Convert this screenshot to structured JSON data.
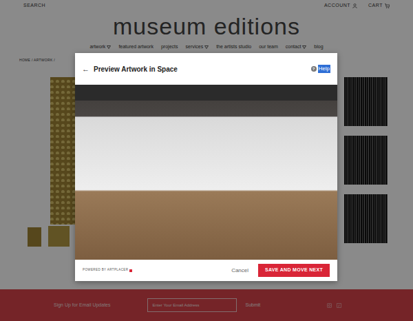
{
  "top_bar": {
    "search": "SEARCH",
    "account": "ACCOUNT",
    "cart": "CART"
  },
  "logo": "museum editions",
  "nav": [
    {
      "label": "artwork",
      "dropdown": true
    },
    {
      "label": "featured artwork",
      "dropdown": false
    },
    {
      "label": "projects",
      "dropdown": false
    },
    {
      "label": "services",
      "dropdown": true
    },
    {
      "label": "the artists studio",
      "dropdown": false
    },
    {
      "label": "our team",
      "dropdown": false
    },
    {
      "label": "contact",
      "dropdown": true
    },
    {
      "label": "blog",
      "dropdown": false
    }
  ],
  "breadcrumb": "HOME / ARTWORK /",
  "modal": {
    "back": "←",
    "title": "Preview Artwork in Space",
    "help_icon": "?",
    "help": {
      "label": "Help",
      "selected": true
    },
    "powered_by": "POWERED BY ARTPLACER",
    "cancel": "Cancel",
    "save": "SAVE AND MOVE NEXT"
  },
  "footer": {
    "signup": "Sign Up for Email Updates",
    "email_placeholder": "Enter Your Email Address",
    "submit": "Submit"
  }
}
